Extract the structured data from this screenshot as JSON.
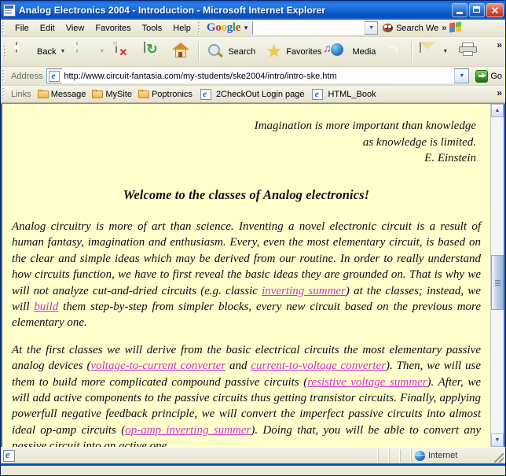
{
  "window": {
    "title": "Analog Electronics 2004 - Introduction - Microsoft Internet Explorer",
    "icon": "ie-document-icon",
    "minimize_label": "",
    "maximize_label": "",
    "close_label": "✕"
  },
  "menubar": {
    "items": [
      {
        "label": "File"
      },
      {
        "label": "Edit"
      },
      {
        "label": "View"
      },
      {
        "label": "Favorites"
      },
      {
        "label": "Tools"
      },
      {
        "label": "Help"
      }
    ],
    "google": {
      "logo_letters": [
        "G",
        "o",
        "o",
        "g",
        "l",
        "e"
      ],
      "caret": "▼",
      "search_value": "",
      "search_placeholder": "",
      "dropdown_caret": "▼",
      "search_web_label": "Search We",
      "overflow_caret": "»"
    }
  },
  "toolbar": {
    "back_label": "Back",
    "back_caret": "▼",
    "forward_label": "",
    "forward_caret": "▼",
    "stop_label": "",
    "refresh_label": "",
    "home_label": "",
    "search_label": "Search",
    "favorites_label": "Favorites",
    "media_label": "Media",
    "history_label": "",
    "mail_label": "",
    "mail_caret": "▼",
    "print_label": "",
    "overflow_caret": "»"
  },
  "address": {
    "label": "Address",
    "url": "http://www.circuit-fantasia.com/my-students/ske2004/intro/intro-ske.htm",
    "placeholder": "",
    "dropdown_caret": "▼",
    "go_label": "Go"
  },
  "links": {
    "label": "Links",
    "items": [
      {
        "label": "Message",
        "icon": "folder-icon"
      },
      {
        "label": "MySite",
        "icon": "folder-icon"
      },
      {
        "label": "Poptronics",
        "icon": "folder-icon"
      },
      {
        "label": "2CheckOut Login page",
        "icon": "ie-document-icon"
      },
      {
        "label": "HTML_Book",
        "icon": "ie-document-icon"
      }
    ],
    "overflow_caret": "»"
  },
  "page": {
    "background_color": "#ffffcc",
    "link_color": "#cc33cc",
    "text_color": "#0a0a14",
    "quote": {
      "line1": "Imagination is more important than knowledge",
      "line2": "as knowledge is limited.",
      "attribution": "E. Einstein"
    },
    "heading": "Welcome to the classes of Analog electronics!",
    "paragraph1": {
      "part1": "Analog circuitry is more of art than science. Inventing a novel electronic circuit is a result of human fantasy, imagination and enthusiasm. Every, even the most elementary circuit, is based on the clear and simple ideas which may be derived from our routine. In order to really understand how circuits function, we have to first reveal the basic ideas they are grounded on. That is why we will not analyze cut-and-dried circuits (e.g. classic ",
      "link1": "inverting summer",
      "part2": ") at the classes; instead, we will ",
      "link2": "build",
      "part3": " them step-by-step from simpler blocks, every new circuit based on the previous more elementary one."
    },
    "paragraph2": {
      "part1": "At the first classes we will derive from the basic electrical circuits the most elementary passive analog devices (",
      "link1": "voltage-to-current converter",
      "part2": " and ",
      "link2": "current-to-voltage converter",
      "part3": "). Then, we will use them to build more complicated compound passive circuits (",
      "link3": "resistive voltage summer",
      "part4": "). After, we will add active components to the passive circuits thus getting transistor circuits. Finally, applying powerfull negative feedback principle, we will convert the imperfect passive circuits into almost ideal op-amp circuits (",
      "link4": "op-amp inverting summer",
      "part5": "). Doing that, you will be able to convert any passive circuit into an active one."
    },
    "scroll": {
      "up_caret": "▲",
      "down_caret": "▼"
    }
  },
  "statusbar": {
    "message": "",
    "zone_label": "Internet",
    "zone_icon": "globe-icon"
  }
}
